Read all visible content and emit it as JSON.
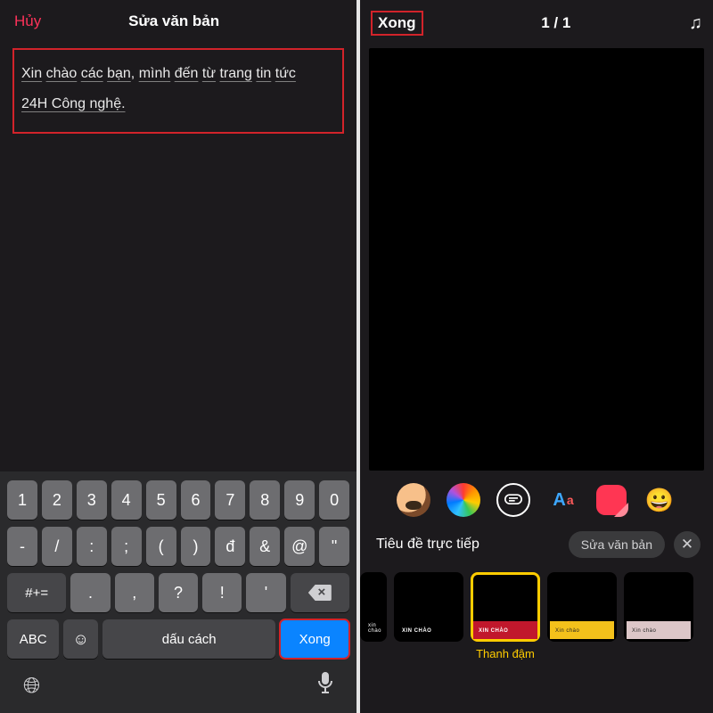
{
  "left": {
    "header": {
      "cancel": "Hủy",
      "title": "Sửa văn bản"
    },
    "text": {
      "w1": "Xin",
      "w2": "chào",
      "w3": "các",
      "w4": "bạn",
      "w5": "mình",
      "w6": "đến",
      "w7": "từ",
      "w8": "trang",
      "w9": "tin",
      "w10": "tức",
      "comma_after_w4": ", ",
      "line2": "24H Công nghệ."
    },
    "keyboard": {
      "r1": [
        "1",
        "2",
        "3",
        "4",
        "5",
        "6",
        "7",
        "8",
        "9",
        "0"
      ],
      "r2": [
        "-",
        "/",
        ":",
        ";",
        "(",
        ")",
        "đ",
        "&",
        "@",
        "\""
      ],
      "r3_shift": "#+=",
      "r3": [
        ".",
        ",",
        "?",
        "!",
        "'"
      ],
      "r4_abc": "ABC",
      "r4_space": "dấu cách",
      "r4_done": "Xong"
    }
  },
  "right": {
    "header": {
      "done": "Xong",
      "count": "1 / 1"
    },
    "titleSection": {
      "label": "Tiêu đề trực tiếp",
      "edit": "Sửa văn bản"
    },
    "thumbs": {
      "t1": "xin chào",
      "t2": "XIN CHÀO",
      "t3": "XIN CHÀO",
      "t4": "Xin chào",
      "t5": "Xin chào",
      "selectedLabel": "Thanh đậm"
    }
  }
}
